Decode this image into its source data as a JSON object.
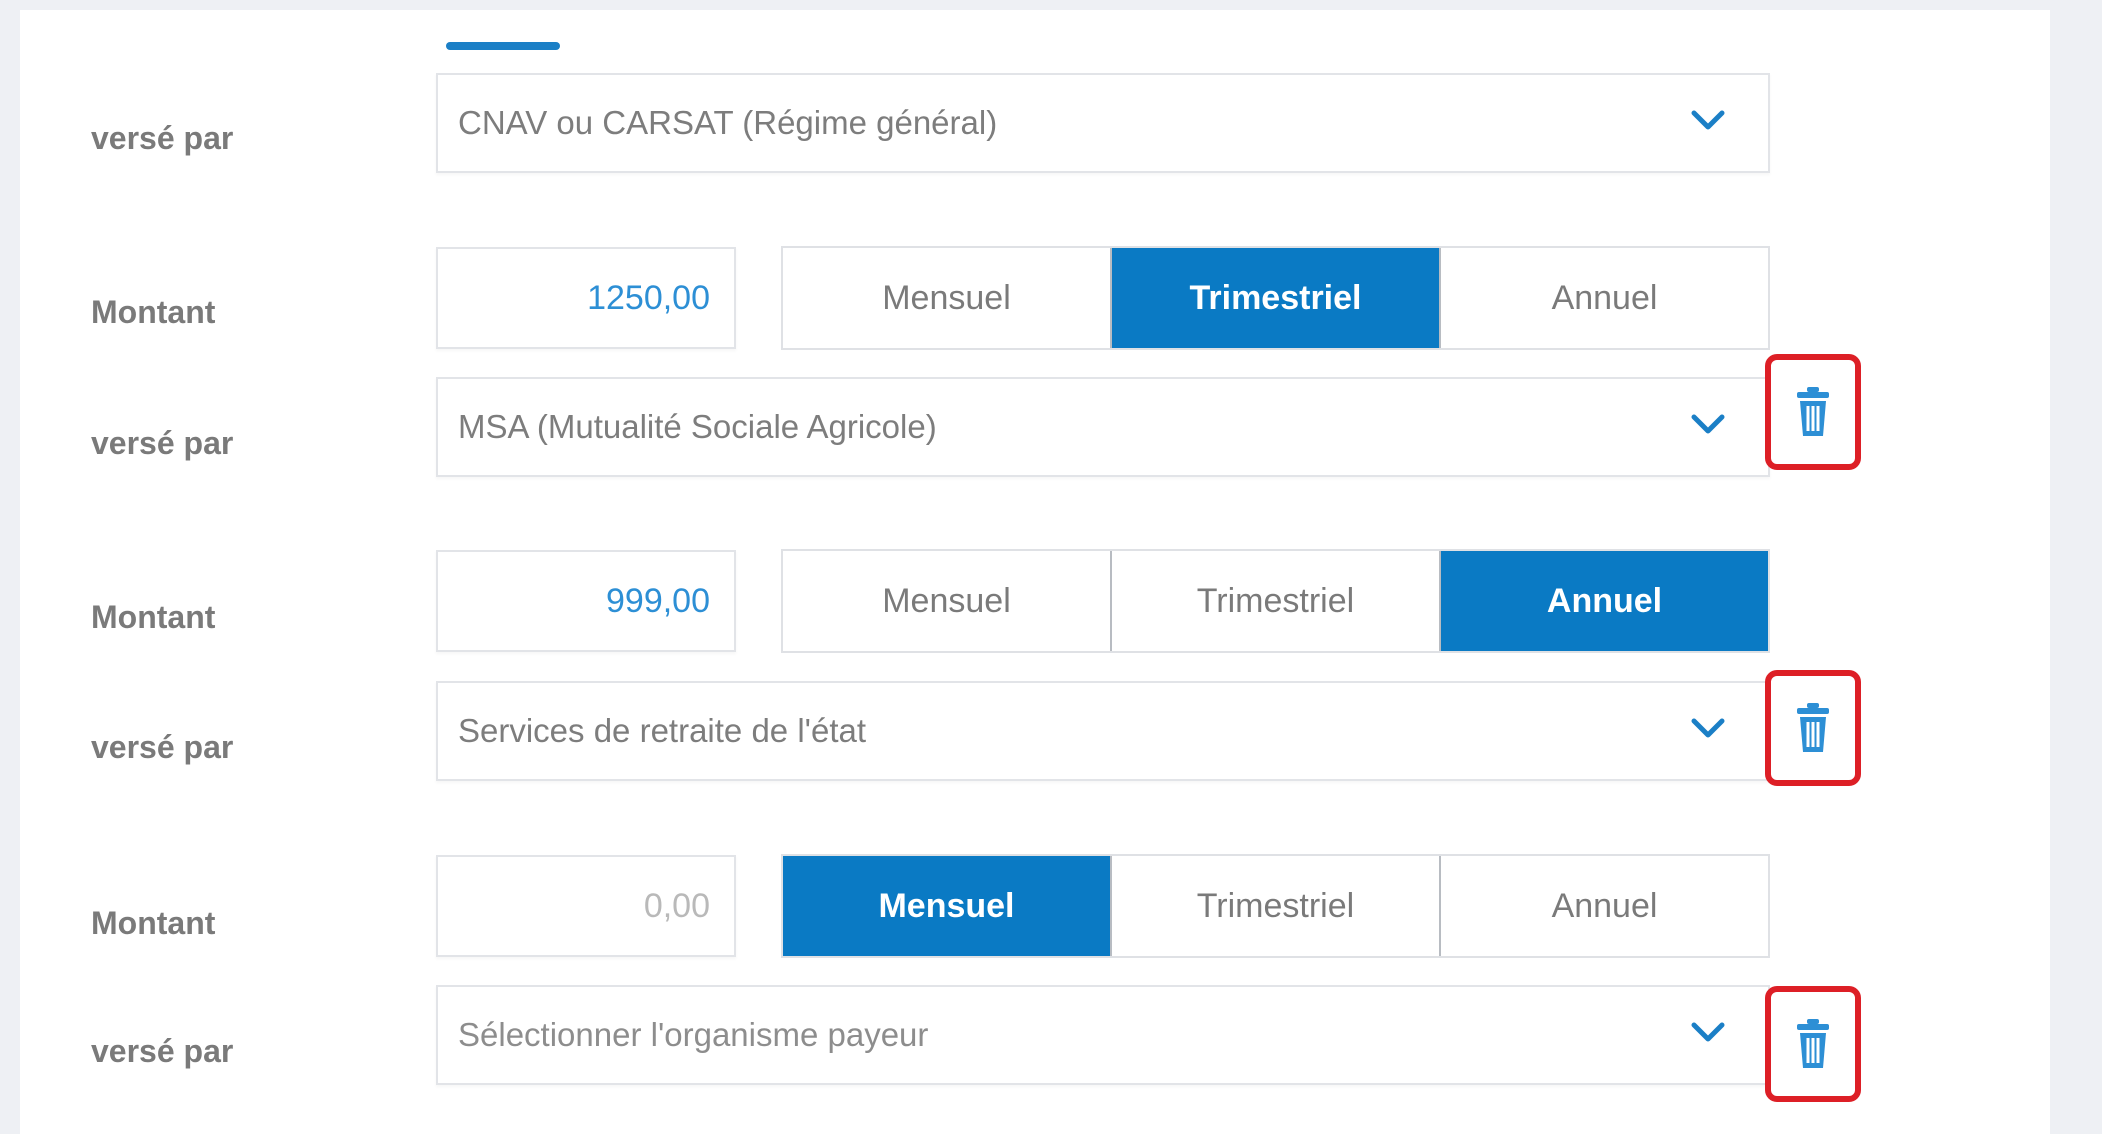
{
  "rows": [
    {
      "verse_label": "versé par",
      "payer": "CNAV ou CARSAT (Régime général)",
      "amount_label": "Montant",
      "amount": "1250,00",
      "periods": [
        "Mensuel",
        "Trimestriel",
        "Annuel"
      ],
      "selected_period": "Trimestriel"
    },
    {
      "verse_label": "versé par",
      "payer": "MSA (Mutualité Sociale Agricole)",
      "amount_label": "Montant",
      "amount": "999,00",
      "periods": [
        "Mensuel",
        "Trimestriel",
        "Annuel"
      ],
      "selected_period": "Annuel"
    },
    {
      "verse_label": "versé par",
      "payer": "Services de retraite de l'état",
      "amount_label": "Montant",
      "amount": "0,00",
      "periods": [
        "Mensuel",
        "Trimestriel",
        "Annuel"
      ],
      "selected_period": "Mensuel"
    },
    {
      "verse_label": "versé par",
      "payer": "Sélectionner l'organisme payeur"
    }
  ],
  "icons": {
    "dropdown": "chevron-down-icon",
    "delete": "trash-icon"
  },
  "colors": {
    "accent": "#0a7ac4",
    "amount_text": "#2d8fd5",
    "highlight_border": "#dd1f26"
  }
}
